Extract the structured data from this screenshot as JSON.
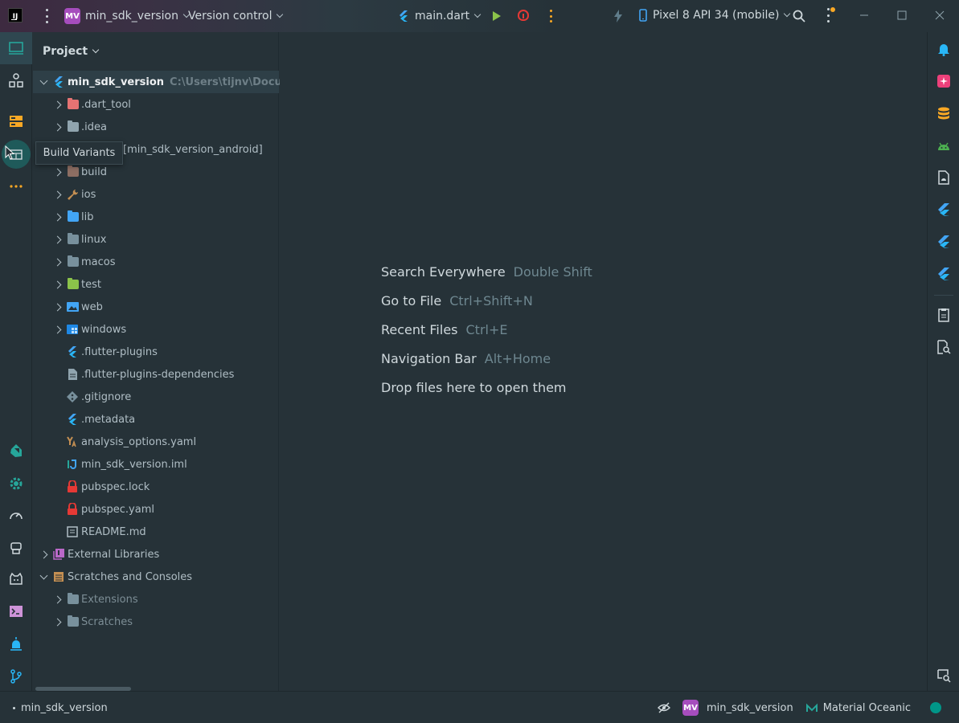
{
  "titlebar": {
    "project_badge": "MV",
    "project_name": "min_sdk_version",
    "vcs_menu": "Version control",
    "run_config": "main.dart",
    "device": "Pixel 8 API 34 (mobile)"
  },
  "tooltip": {
    "text": "Build Variants"
  },
  "project_panel": {
    "title": "Project",
    "tree": [
      {
        "label": "min_sdk_version",
        "note": "C:\\Users\\tijnv\\Document",
        "icon": "flutter-module-icon",
        "color": "#42a5f5"
      },
      {
        "label": ".dart_tool",
        "icon": "folder-icon",
        "color": "#e57373"
      },
      {
        "label": ".idea",
        "icon": "folder-icon",
        "color": "#90a4ae"
      },
      {
        "label": "[min_sdk_version_android]",
        "icon": "android-module-icon",
        "color": "#90a4ae"
      },
      {
        "label": "build",
        "icon": "folder-icon",
        "color": "#8d6e63"
      },
      {
        "label": "ios",
        "icon": "wrench-folder-icon",
        "color": "#c48f52"
      },
      {
        "label": "lib",
        "icon": "folder-icon",
        "color": "#42a5f5"
      },
      {
        "label": "linux",
        "icon": "folder-icon",
        "color": "#78909c"
      },
      {
        "label": "macos",
        "icon": "folder-icon",
        "color": "#78909c"
      },
      {
        "label": "test",
        "icon": "folder-icon",
        "color": "#8bc34a"
      },
      {
        "label": "web",
        "icon": "image-folder-icon",
        "color": "#42a5f5"
      },
      {
        "label": "windows",
        "icon": "windows-folder-icon",
        "color": "#42a5f5"
      },
      {
        "label": ".flutter-plugins",
        "icon": "flutter-file-icon",
        "color": "#42a5f5"
      },
      {
        "label": ".flutter-plugins-dependencies",
        "icon": "text-file-icon",
        "color": "#90a4ae"
      },
      {
        "label": ".gitignore",
        "icon": "git-file-icon",
        "color": "#78909c"
      },
      {
        "label": ".metadata",
        "icon": "flutter-file-icon",
        "color": "#42a5f5"
      },
      {
        "label": "analysis_options.yaml",
        "icon": "yaml-file-icon",
        "color": "#c48f52"
      },
      {
        "label": "min_sdk_version.iml",
        "icon": "iml-file-icon",
        "color": "#26a69a"
      },
      {
        "label": "pubspec.lock",
        "icon": "lock-file-icon",
        "color": "#e53935"
      },
      {
        "label": "pubspec.yaml",
        "icon": "lock-file-icon",
        "color": "#e53935"
      },
      {
        "label": "README.md",
        "icon": "markdown-file-icon",
        "color": "#b0bec5"
      },
      {
        "label": "External Libraries",
        "icon": "library-icon",
        "color": "#ba68c8"
      },
      {
        "label": "Scratches and Consoles",
        "icon": "scratches-icon",
        "color": "#c48f52"
      },
      {
        "label": "Extensions",
        "icon": "folder-icon",
        "color": "#78909c"
      },
      {
        "label": "Scratches",
        "icon": "folder-icon",
        "color": "#78909c"
      }
    ]
  },
  "editor": {
    "hints": [
      {
        "action": "Search Everywhere",
        "key": "Double Shift"
      },
      {
        "action": "Go to File",
        "key": "Ctrl+Shift+N"
      },
      {
        "action": "Recent Files",
        "key": "Ctrl+E"
      },
      {
        "action": "Navigation Bar",
        "key": "Alt+Home"
      },
      {
        "action": "Drop files here to open them",
        "key": ""
      }
    ]
  },
  "statusbar": {
    "breadcrumb": "min_sdk_version",
    "project_badge": "MV",
    "project_name": "min_sdk_version",
    "theme": "Material Oceanic"
  },
  "colors": {
    "background": "#263238",
    "accent": "#009688",
    "project_badge": "#a64dbd"
  }
}
